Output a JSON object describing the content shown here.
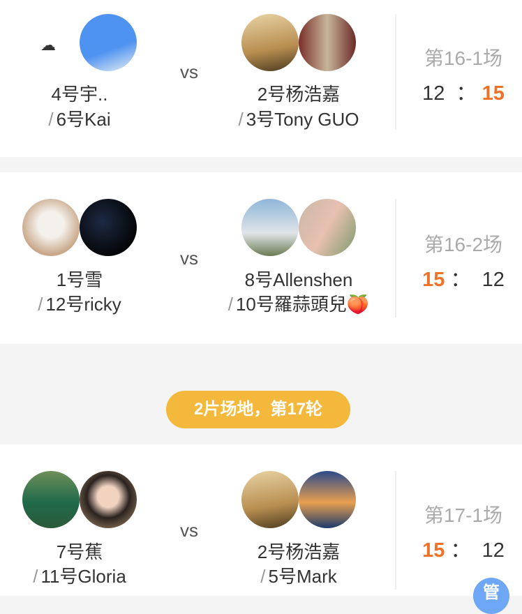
{
  "matches": [
    {
      "team_a": {
        "p1": "4号宇..",
        "p2": "6号Kai"
      },
      "team_b": {
        "p1": "2号杨浩嘉",
        "p2": "3号Tony GUO"
      },
      "vs": "vs",
      "round": "第16-1场",
      "score_a": "12",
      "score_b": "15",
      "sep": "：",
      "winner": "b"
    },
    {
      "team_a": {
        "p1": "1号雪",
        "p2": "12号ricky"
      },
      "team_b": {
        "p1": "8号Allenshen",
        "p2": "10号羅蒜頭兒🍑"
      },
      "vs": "vs",
      "round": "第16-2场",
      "score_a": "15",
      "score_b": "12",
      "sep": "：",
      "winner": "a"
    },
    {
      "team_a": {
        "p1": "7号蕉",
        "p2": "11号Gloria"
      },
      "team_b": {
        "p1": "2号杨浩嘉",
        "p2": "5号Mark"
      },
      "vs": "vs",
      "round": "第17-1场",
      "score_a": "15",
      "score_b": "12",
      "sep": "：",
      "winner": "a"
    }
  ],
  "slash": "/",
  "round_badge": "2片场地，第17轮",
  "manage_button": "管",
  "colors": {
    "accent_orange": "#f07128",
    "badge_yellow": "#f4b93c",
    "manage_blue": "#6ea7f5"
  }
}
